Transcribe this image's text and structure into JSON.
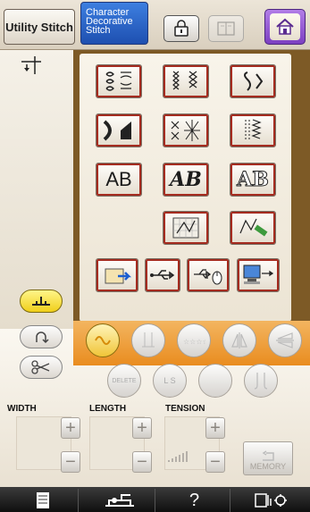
{
  "tabs": {
    "utility": "Utility Stitch",
    "character": "Character\nDecorative\nStitch"
  },
  "stitch_font_labels": [
    "AB",
    "AB",
    "AB"
  ],
  "edit_buttons": {
    "delete": "DELETE",
    "ls": "L S"
  },
  "params": {
    "width": "WIDTH",
    "length": "LENGTH",
    "tension": "TENSION"
  },
  "memory_label": "MEMORY",
  "nav": {
    "help": "?"
  },
  "colors": {
    "accent_orange": "#e98c1f",
    "home_purple": "#7c3fc2",
    "tab_blue": "#1e4fb0",
    "frame_red": "#a42b1f",
    "presser_yellow": "#f0cf1a"
  }
}
